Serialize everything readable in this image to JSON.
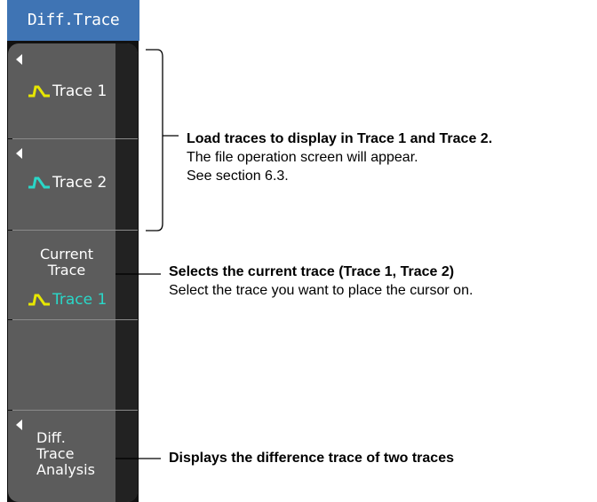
{
  "panel": {
    "title": "Diff.Trace",
    "keys": [
      {
        "label": "Trace 1",
        "icon_color": "#e6e600"
      },
      {
        "label": "Trace 2",
        "icon_color": "#2ad7c8"
      },
      {
        "label_line1": "Current",
        "label_line2": "Trace",
        "value": "Trace 1",
        "value_color": "#2ad7c8",
        "icon_color": "#e6e600"
      },
      {
        "label_line1": "Diff.",
        "label_line2": "Trace",
        "label_line3": "Analysis"
      }
    ]
  },
  "annotations": {
    "load": {
      "heading": "Load traces to display in Trace 1 and Trace 2.",
      "line2": "The file operation screen will appear.",
      "line3": "See section 6.3."
    },
    "current": {
      "heading": "Selects the current trace (Trace 1, Trace 2)",
      "line2": "Select the trace you want to place the cursor on."
    },
    "diff": {
      "heading": "Displays the difference trace of two traces"
    }
  }
}
